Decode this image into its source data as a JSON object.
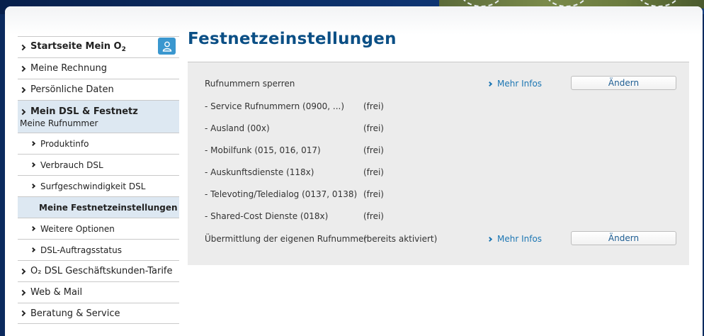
{
  "sidebar": {
    "items": [
      {
        "label": "Startseite Mein O",
        "sub": "2"
      },
      {
        "label": "Meine Rechnung"
      },
      {
        "label": "Persönliche Daten"
      },
      {
        "label": "Mein DSL & Festnetz",
        "subtitle": "Meine Rufnummer"
      },
      {
        "label": "Produktinfo"
      },
      {
        "label": "Verbrauch DSL"
      },
      {
        "label": "Surfgeschwindigkeit DSL"
      },
      {
        "label": "Meine Festnetzeinstellungen"
      },
      {
        "label": "Weitere Optionen"
      },
      {
        "label": "DSL-Auftragsstatus"
      },
      {
        "label": "O₂ DSL Geschäftskunden-Tarife"
      },
      {
        "label": "Web & Mail"
      },
      {
        "label": "Beratung & Service"
      }
    ]
  },
  "main": {
    "title": "Festnetzeinstellungen",
    "rows": [
      {
        "label": "Rufnummern sperren",
        "value": "",
        "link": "Mehr Infos",
        "button": "Ändern"
      },
      {
        "label": "- Service Rufnummern (0900, ...)",
        "value": "(frei)"
      },
      {
        "label": "- Ausland (00x)",
        "value": "(frei)"
      },
      {
        "label": "- Mobilfunk (015, 016, 017)",
        "value": "(frei)"
      },
      {
        "label": "- Auskunftsdienste (118x)",
        "value": "(frei)"
      },
      {
        "label": "- Televoting/Teledialog (0137, 0138)",
        "value": "(frei)"
      },
      {
        "label": "- Shared-Cost Dienste (018x)",
        "value": "(frei)"
      },
      {
        "label": "Übermittlung der eigenen Rufnummer",
        "value": "(bereits aktiviert)",
        "link": "Mehr Infos",
        "button": "Ändern"
      }
    ]
  },
  "colors": {
    "accent": "#0b4f85",
    "link": "#1c76b3",
    "active_bg": "#dde8f2",
    "panel_bg": "#ececec"
  }
}
